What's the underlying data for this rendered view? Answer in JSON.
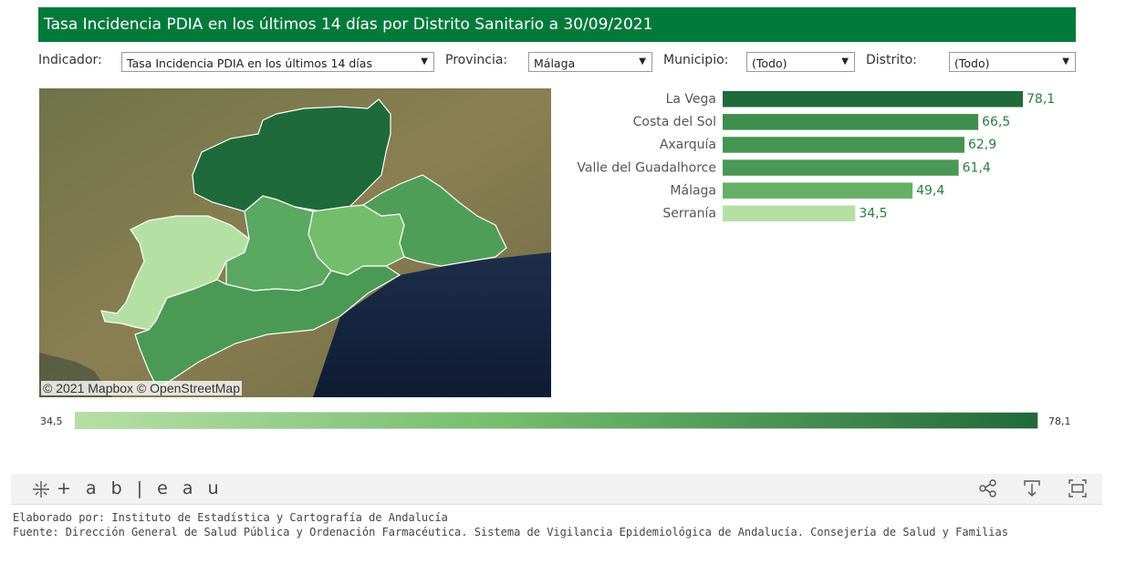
{
  "title": "Tasa Incidencia PDIA en los últimos 14 días por Distrito Sanitario a 30/09/2021",
  "filters": {
    "indicador": {
      "label": "Indicador:",
      "value": "Tasa Incidencia PDIA en los últimos 14 días"
    },
    "provincia": {
      "label": "Provincia:",
      "value": "Málaga"
    },
    "municipio": {
      "label": "Municipio:",
      "value": "(Todo)"
    },
    "distrito": {
      "label": "Distrito:",
      "value": "(Todo)"
    }
  },
  "map": {
    "attribution": "© 2021 Mapbox  © OpenStreetMap",
    "district_colors": {
      "La Vega": "#1f6a3a",
      "Costa del Sol": "#4a9a55",
      "Axarquía": "#4f9e58",
      "Valle del Guadalhorce": "#5aa862",
      "Málaga": "#74bd6c",
      "Serranía": "#b5e0a4"
    }
  },
  "chart_data": {
    "type": "bar",
    "orientation": "horizontal",
    "categories": [
      "La Vega",
      "Costa del Sol",
      "Axarquía",
      "Valle del Guadalhorce",
      "Málaga",
      "Serranía"
    ],
    "values": [
      78.1,
      66.5,
      62.9,
      61.4,
      49.4,
      34.5
    ],
    "value_labels": [
      "78,1",
      "66,5",
      "62,9",
      "61,4",
      "49,4",
      "34,5"
    ],
    "colors": [
      "#1f6a3a",
      "#3f8e4e",
      "#469452",
      "#4a9856",
      "#66b066",
      "#b5e0a4"
    ]
  },
  "legend": {
    "min": "34,5",
    "max": "78,1",
    "color_start": "#b5e0a4",
    "color_end": "#1f6a3a"
  },
  "tableau": {
    "logo": "+ a b | e a u",
    "icons": [
      "share-icon",
      "download-icon",
      "fullscreen-icon"
    ]
  },
  "footer": {
    "line1": "Elaborado por: Instituto de Estadística y Cartografía de Andalucía",
    "line2": "Fuente: Dirección General de Salud Pública y Ordenación Farmacéutica. Sistema de Vigilancia Epidemiológica de Andalucía. Consejería de Salud y Familias"
  }
}
